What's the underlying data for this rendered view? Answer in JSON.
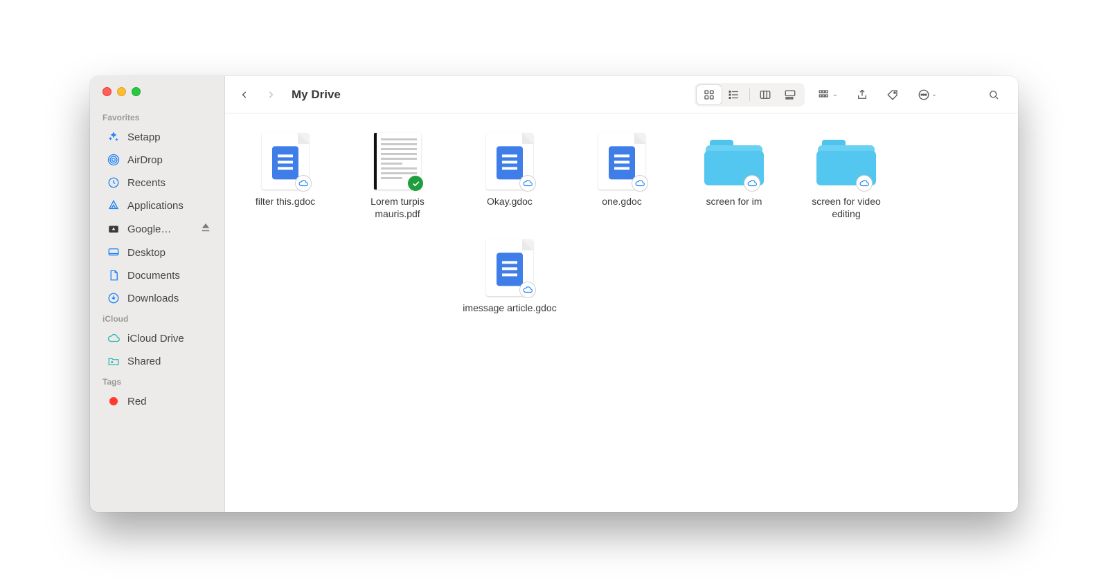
{
  "window_title": "My Drive",
  "sidebar": {
    "sections": {
      "favorites": {
        "label": "Favorites",
        "items": [
          {
            "label": "Setapp"
          },
          {
            "label": "AirDrop"
          },
          {
            "label": "Recents"
          },
          {
            "label": "Applications"
          },
          {
            "label": "Google…",
            "eject": true
          },
          {
            "label": "Desktop"
          },
          {
            "label": "Documents"
          },
          {
            "label": "Downloads"
          }
        ]
      },
      "icloud": {
        "label": "iCloud",
        "items": [
          {
            "label": "iCloud Drive"
          },
          {
            "label": "Shared"
          }
        ]
      },
      "tags": {
        "label": "Tags",
        "items": [
          {
            "label": "Red",
            "color": "#ff3b30"
          }
        ]
      }
    }
  },
  "files": {
    "row1": [
      {
        "name": "filter this.gdoc",
        "kind": "gdoc",
        "badge": "cloud"
      },
      {
        "name": "Lorem turpis mauris.pdf",
        "kind": "pdf",
        "badge": "check"
      },
      {
        "name": "Okay.gdoc",
        "kind": "gdoc",
        "badge": "cloud"
      },
      {
        "name": "one.gdoc",
        "kind": "gdoc",
        "badge": "cloud"
      },
      {
        "name": "screen for im",
        "kind": "folder",
        "badge": "cloud"
      },
      {
        "name": "screen for video editing",
        "kind": "folder",
        "badge": "cloud"
      }
    ],
    "row2": [
      {
        "name": "imessage article.gdoc",
        "kind": "gdoc",
        "badge": "cloud",
        "col": 3
      }
    ]
  }
}
